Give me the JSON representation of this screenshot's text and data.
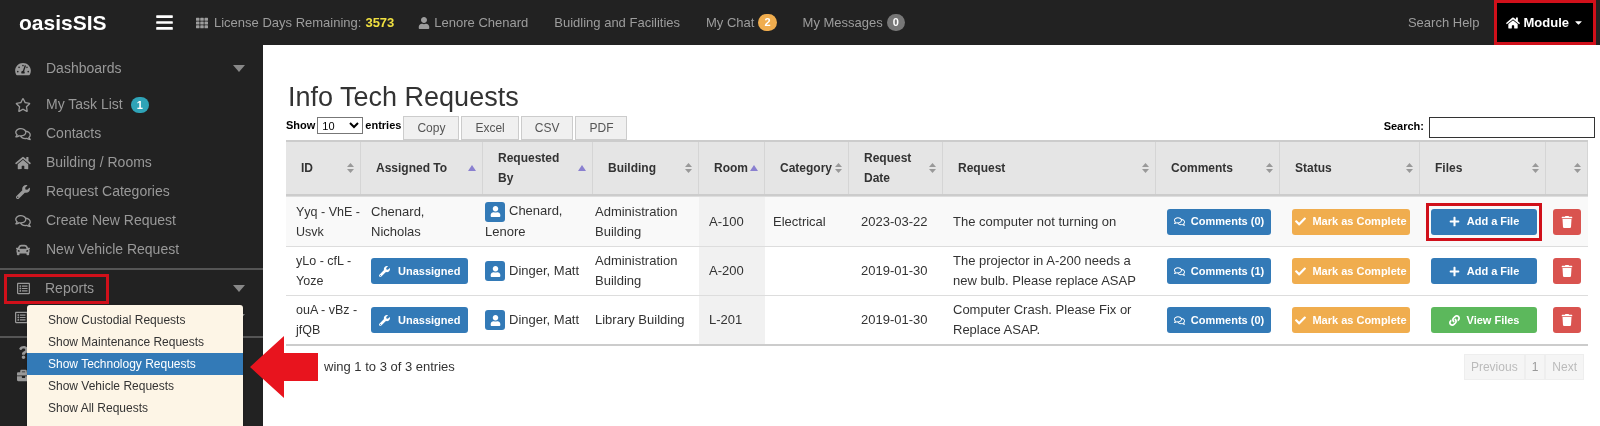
{
  "topbar": {
    "logo": "oasisSIS",
    "license_label": "License Days Remaining:",
    "license_days": "3573",
    "user": "Lenore Chenard",
    "links": [
      {
        "label": "Buidling and Facilities"
      },
      {
        "label": "My Chat",
        "badge": "2",
        "color": "#f0ad4e"
      },
      {
        "label": "My Messages",
        "badge": "0",
        "color": "#777777"
      }
    ],
    "search_help": "Search Help",
    "module": {
      "label": "Module",
      "highlighted": true
    }
  },
  "sidebar": {
    "items": [
      {
        "label": "Dashboards",
        "expandable": true
      },
      {
        "label": "My Task List",
        "badge": "1",
        "expandable": false
      },
      {
        "label": "Contacts",
        "expandable": false
      },
      {
        "label": "Building / Rooms",
        "expandable": false
      },
      {
        "label": "Request Categories",
        "expandable": false
      },
      {
        "label": "Create New Request",
        "expandable": false
      },
      {
        "label": "New Vehicle Request",
        "expandable": false
      }
    ],
    "reports": {
      "label": "Reports",
      "highlighted": true
    }
  },
  "reports_menu": [
    {
      "label": "Show Custodial Requests",
      "selected": false
    },
    {
      "label": "Show Maintenance Requests",
      "selected": false
    },
    {
      "label": "Show Technology Requests",
      "selected": true
    },
    {
      "label": "Show Vehicle Requests",
      "selected": false
    },
    {
      "label": "Show All Requests",
      "selected": false
    }
  ],
  "page": {
    "title": "Info Tech Requests",
    "show_label": "Show",
    "page_size": "10",
    "entries_label": "entries",
    "export_buttons": [
      "Copy",
      "Excel",
      "CSV",
      "PDF"
    ],
    "search_label": "Search:"
  },
  "table": {
    "columns": [
      {
        "label": "ID",
        "sorted": false
      },
      {
        "label": "Assigned To",
        "sorted": true
      },
      {
        "label": "Requested By",
        "sorted": true
      },
      {
        "label": "Building",
        "sorted": false
      },
      {
        "label": "Room",
        "sorted": true
      },
      {
        "label": "Category",
        "sorted": false
      },
      {
        "label": "Request Date",
        "sorted": false
      },
      {
        "label": "Request",
        "sorted": false
      },
      {
        "label": "Comments",
        "sorted": false
      },
      {
        "label": "Status",
        "sorted": false
      },
      {
        "label": "Files",
        "sorted": false
      },
      {
        "sorted": false
      }
    ],
    "rows": [
      {
        "id": "Yyq - VhE - Usvk",
        "assigned": {
          "kind": "text",
          "label": "Chenard, Nicholas"
        },
        "requested_by": "Chenard, Lenore",
        "building": "Administration Building",
        "room": "A-100",
        "category": "Electrical",
        "date": "2023-03-22",
        "request": "The computer not turning on",
        "comments": "Comments (0)",
        "status": "Mark as Complete",
        "files": {
          "kind": "add",
          "label": "Add a File",
          "highlighted": true
        }
      },
      {
        "id": "yLo - cfL - Yoze",
        "assigned": {
          "kind": "button",
          "label": "Unassigned"
        },
        "requested_by": "Dinger, Matt",
        "building": "Administration Building",
        "room": "A-200",
        "date": "2019-01-30",
        "request": "The projector in A-200 needs a new bulb. Please replace ASAP",
        "comments": "Comments (1)",
        "status": "Mark as Complete",
        "files": {
          "kind": "add",
          "label": "Add a File",
          "highlighted": false
        }
      },
      {
        "id": "ouA - vBz - jfQB",
        "assigned": {
          "kind": "button",
          "label": "Unassigned"
        },
        "requested_by": "Dinger, Matt",
        "building": "Library Building",
        "room": "L-201",
        "date": "2019-01-30",
        "request": "Computer Crash. Please Fix or Replace ASAP.",
        "comments": "Comments (0)",
        "status": "Mark as Complete",
        "files": {
          "kind": "view",
          "label": "View Files",
          "highlighted": false
        }
      }
    ]
  },
  "footer": {
    "info": "wing 1 to 3 of 3 entries",
    "pagination": [
      {
        "label": "Previous",
        "disabled": true
      },
      {
        "label": "1",
        "disabled": false
      },
      {
        "label": "Next",
        "disabled": true
      }
    ]
  }
}
